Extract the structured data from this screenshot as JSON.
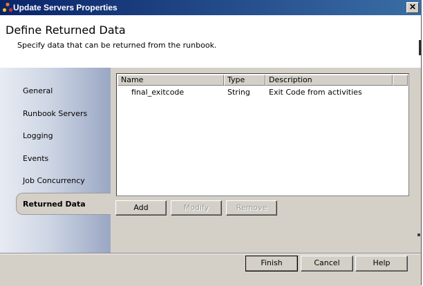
{
  "window": {
    "title": "Update Servers Properties",
    "close_label": "✕"
  },
  "header": {
    "title": "Define Returned Data",
    "subtitle": "Specify data that can be returned from the runbook."
  },
  "sidebar": {
    "items": [
      {
        "label": "General"
      },
      {
        "label": "Runbook Servers"
      },
      {
        "label": "Logging"
      },
      {
        "label": "Events"
      },
      {
        "label": "Job Concurrency"
      },
      {
        "label": "Returned Data",
        "active": true
      }
    ]
  },
  "grid": {
    "columns": [
      "Name",
      "Type",
      "Description"
    ],
    "rows": [
      {
        "name": "final_exitcode",
        "type": "String",
        "description": "Exit Code from activities"
      }
    ]
  },
  "grid_buttons": {
    "add": "Add",
    "modify": "Modify",
    "remove": "Remove"
  },
  "footer": {
    "finish": "Finish",
    "cancel": "Cancel",
    "help": "Help"
  }
}
